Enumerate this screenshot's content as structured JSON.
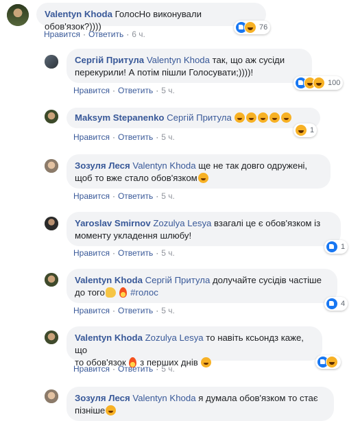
{
  "ui": {
    "like": "Нравится",
    "reply": "Ответить",
    "dot": "·"
  },
  "colors": {
    "link": "#385898",
    "bubble": "#f2f3f5",
    "like": "#1877f2",
    "haha": "#f7b125"
  },
  "comments": [
    {
      "author": "Valentyn Khoda",
      "mention": "",
      "text": " ГолосНо виконували обов'язок?))))",
      "time": "6 ч.",
      "reactions": [
        "like-icon",
        "haha-icon"
      ],
      "reaction_count": "76"
    },
    {
      "author": "Сергій Притула",
      "mention": "Valentyn Khoda",
      "text_line1": " так, що аж сусіди",
      "text_line2": "перекурили! А потім пішли Голосувати;))))!",
      "time": "5 ч.",
      "reactions": [
        "like-icon",
        "haha-icon",
        "laughing-emoji"
      ],
      "reaction_count": "100"
    },
    {
      "author": "Maksym Stepanenko",
      "mention": "Сергій Притула",
      "text": "",
      "emoji": [
        "rofl-emoji",
        "rofl-emoji",
        "rofl-emoji",
        "rofl-emoji",
        "rofl-emoji"
      ],
      "time": "5 ч.",
      "reactions": [
        "haha-icon"
      ],
      "reaction_count": "1"
    },
    {
      "author": "Зозуля Леся",
      "mention": "Valentyn Khoda",
      "text_line1": " ще не так довго одружені,",
      "text_line2": "щоб то вже стало обов'язком",
      "emoji": [
        "wink-emoji"
      ],
      "time": "5 ч."
    },
    {
      "author": "Yaroslav Smirnov",
      "mention": "Zozulya Lesya",
      "text_line1": " взагалі це є обов'язком із",
      "text_line2": "моменту укладення шлюбу!",
      "time": "5 ч.",
      "reactions": [
        "like-icon"
      ],
      "reaction_count": "1"
    },
    {
      "author": "Valentyn Khoda",
      "mention": "Сергій Притула",
      "text_line1": " долучайте сусідів частіше",
      "text_line2": "до того",
      "hashtag": "#голос",
      "emoji": [
        "muscle-emoji",
        "fire-emoji"
      ],
      "time": "5 ч.",
      "reactions": [
        "like-icon"
      ],
      "reaction_count": "4"
    },
    {
      "author": "Valentyn Khoda",
      "mention": "Zozulya Lesya",
      "text_line1": " то навіть ксьондз каже, що",
      "text_line2a": "то обов'язок ",
      "text_line2b": " з перших днів ",
      "emoji": [
        "fire-emoji",
        "laughing-emoji"
      ],
      "time": "5 ч.",
      "reactions": [
        "like-icon",
        "haha-icon"
      ],
      "reaction_count": ""
    },
    {
      "author": "Зозуля Леся",
      "mention": "Valentyn Khoda",
      "text_line1": " я думала обов'язком то стає",
      "text_line2": "пізніше",
      "emoji": [
        "grin-emoji"
      ]
    }
  ]
}
